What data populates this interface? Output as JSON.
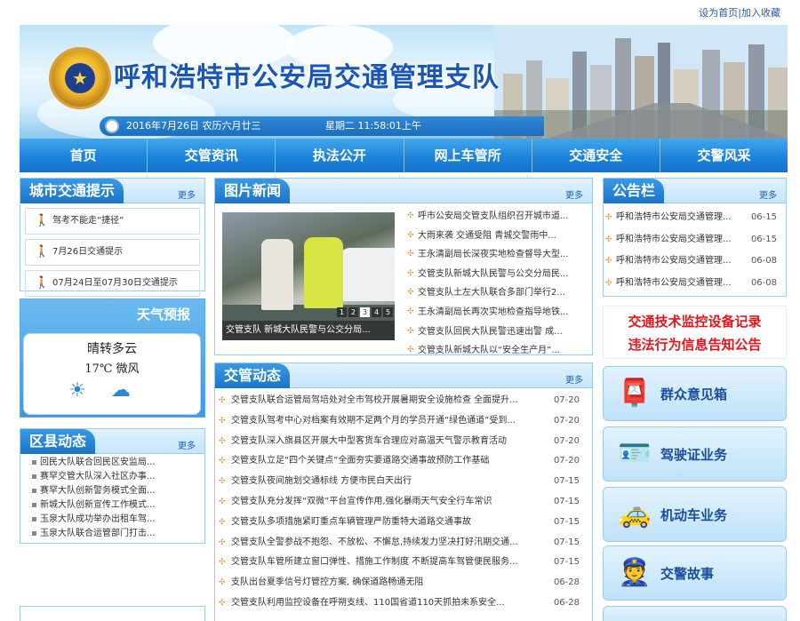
{
  "toplinks": {
    "home": "设为首页",
    "sep": "|",
    "fav": "加入收藏"
  },
  "banner": {
    "title": "呼和浩特市公安局交通管理支队",
    "date": "2016年7月26日  农历六月廿三",
    "time": "星期二  11:58:01上午"
  },
  "nav": [
    "首页",
    "交管资讯",
    "执法公开",
    "网上车管所",
    "交通安全",
    "交警风采"
  ],
  "traffic": {
    "title": "城市交通提示",
    "more": "更多",
    "items": [
      "驾考不能走“捷径”",
      "7月26日交通提示",
      "07月24日至07月30日交通提示"
    ]
  },
  "weather": {
    "title": "天气预报",
    "desc": "晴转多云",
    "temp": "17℃  微风",
    "icons": [
      "sun-icon",
      "cloud-icon"
    ]
  },
  "district": {
    "title": "区县动态",
    "more": "更多",
    "items": [
      "回民大队联合回民区安监局...",
      "赛罕交管大队深入社区办事...",
      "赛罕大队创新警务模式全面...",
      "新城大队创新宣传工作模式...",
      "玉泉大队成功举办出租车驾...",
      "玉泉大队联合运管部门打击..."
    ]
  },
  "photo_news": {
    "title": "图片新闻",
    "more": "更多",
    "caption": "交管支队 新城大队民警与公交分局...",
    "pages": [
      "1",
      "2",
      "3",
      "4",
      "5"
    ],
    "items": [
      "呼市公安局交管支队组织召开城市道...",
      "大雨来袭 交通受阻 青城交警雨中...",
      "王永清副局长深夜实地检查督导大型...",
      "交管支队新城大队民警与公交分局民...",
      "交管支队土左大队联合多部门举行2...",
      "王永清副局长再次实地检查指导地铁...",
      "交管支队回民大队民警迅速出警 成...",
      "交管支队新城大队以“安全生产月”..."
    ]
  },
  "jg_news": {
    "title": "交管动态",
    "more": "更多",
    "items": [
      {
        "text": "交管支队联合运管局驾培处对全市驾校开展暑期安全设施检查 全面提升...",
        "date": "07-20"
      },
      {
        "text": "交管支队驾考中心对档案有效期不足两个月的学员开通“绿色通道”受到...",
        "date": "07-20"
      },
      {
        "text": "交管支队深入旗县区开展大中型客货车合理应对高温天气警示教育活动",
        "date": "07-20"
      },
      {
        "text": "交管支队立足“四个关键点”全面夯实要道路交通事故预防工作基础",
        "date": "07-20"
      },
      {
        "text": "交管支队夜间施划交通标线 方便市民白天出行",
        "date": "07-15"
      },
      {
        "text": "交管支队充分发挥“双微”平台宣传作用,强化暴雨天气安全行车常识",
        "date": "07-15"
      },
      {
        "text": "交管支队多项措施紧盯重点车辆管理严防重特大道路交通事故",
        "date": "07-15"
      },
      {
        "text": "交管支队全警参战不抱怨、不放松、不懈怠,持续发力坚决打好汛期交通...",
        "date": "07-15"
      },
      {
        "text": "交管支队车管所建立窗口弹性、措施工作制度 不断提高车驾管便民服务...",
        "date": "07-15"
      },
      {
        "text": "支队出台夏季信号灯管控方案, 确保道路畅通无阻",
        "date": "06-28"
      },
      {
        "text": "交管支队利用监控设备在呼朔支线、110国省道110天抓拍未系安全...",
        "date": "06-28"
      }
    ]
  },
  "bulletin": {
    "title": "公告栏",
    "more": "更多",
    "items": [
      {
        "text": "呼和浩特市公安局交通管理...",
        "date": "06-15"
      },
      {
        "text": "呼和浩特市公安局交通管理...",
        "date": "06-15"
      },
      {
        "text": "呼和浩特市公安局交通管理...",
        "date": "06-08"
      },
      {
        "text": "呼和浩特市公安局交通管理...",
        "date": "06-08"
      }
    ]
  },
  "notice": {
    "line1": "交通技术监控设备记录",
    "line2": "违法行为信息告知公告"
  },
  "services": [
    {
      "label": "群众意见箱",
      "icon": "mailbox-icon"
    },
    {
      "label": "驾驶证业务",
      "icon": "license-card-icon"
    },
    {
      "label": "机动车业务",
      "icon": "car-icon"
    },
    {
      "label": "交警故事",
      "icon": "police-officer-icon"
    }
  ]
}
